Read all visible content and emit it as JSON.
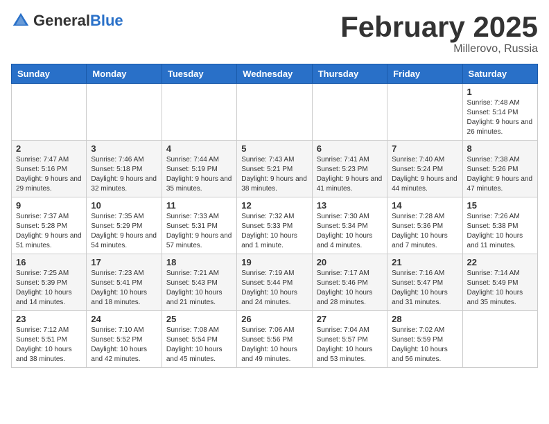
{
  "header": {
    "logo_general": "General",
    "logo_blue": "Blue",
    "month_title": "February 2025",
    "subtitle": "Millerovo, Russia"
  },
  "days_of_week": [
    "Sunday",
    "Monday",
    "Tuesday",
    "Wednesday",
    "Thursday",
    "Friday",
    "Saturday"
  ],
  "weeks": [
    [
      {
        "day": "",
        "detail": ""
      },
      {
        "day": "",
        "detail": ""
      },
      {
        "day": "",
        "detail": ""
      },
      {
        "day": "",
        "detail": ""
      },
      {
        "day": "",
        "detail": ""
      },
      {
        "day": "",
        "detail": ""
      },
      {
        "day": "1",
        "detail": "Sunrise: 7:48 AM\nSunset: 5:14 PM\nDaylight: 9 hours and 26 minutes."
      }
    ],
    [
      {
        "day": "2",
        "detail": "Sunrise: 7:47 AM\nSunset: 5:16 PM\nDaylight: 9 hours and 29 minutes."
      },
      {
        "day": "3",
        "detail": "Sunrise: 7:46 AM\nSunset: 5:18 PM\nDaylight: 9 hours and 32 minutes."
      },
      {
        "day": "4",
        "detail": "Sunrise: 7:44 AM\nSunset: 5:19 PM\nDaylight: 9 hours and 35 minutes."
      },
      {
        "day": "5",
        "detail": "Sunrise: 7:43 AM\nSunset: 5:21 PM\nDaylight: 9 hours and 38 minutes."
      },
      {
        "day": "6",
        "detail": "Sunrise: 7:41 AM\nSunset: 5:23 PM\nDaylight: 9 hours and 41 minutes."
      },
      {
        "day": "7",
        "detail": "Sunrise: 7:40 AM\nSunset: 5:24 PM\nDaylight: 9 hours and 44 minutes."
      },
      {
        "day": "8",
        "detail": "Sunrise: 7:38 AM\nSunset: 5:26 PM\nDaylight: 9 hours and 47 minutes."
      }
    ],
    [
      {
        "day": "9",
        "detail": "Sunrise: 7:37 AM\nSunset: 5:28 PM\nDaylight: 9 hours and 51 minutes."
      },
      {
        "day": "10",
        "detail": "Sunrise: 7:35 AM\nSunset: 5:29 PM\nDaylight: 9 hours and 54 minutes."
      },
      {
        "day": "11",
        "detail": "Sunrise: 7:33 AM\nSunset: 5:31 PM\nDaylight: 9 hours and 57 minutes."
      },
      {
        "day": "12",
        "detail": "Sunrise: 7:32 AM\nSunset: 5:33 PM\nDaylight: 10 hours and 1 minute."
      },
      {
        "day": "13",
        "detail": "Sunrise: 7:30 AM\nSunset: 5:34 PM\nDaylight: 10 hours and 4 minutes."
      },
      {
        "day": "14",
        "detail": "Sunrise: 7:28 AM\nSunset: 5:36 PM\nDaylight: 10 hours and 7 minutes."
      },
      {
        "day": "15",
        "detail": "Sunrise: 7:26 AM\nSunset: 5:38 PM\nDaylight: 10 hours and 11 minutes."
      }
    ],
    [
      {
        "day": "16",
        "detail": "Sunrise: 7:25 AM\nSunset: 5:39 PM\nDaylight: 10 hours and 14 minutes."
      },
      {
        "day": "17",
        "detail": "Sunrise: 7:23 AM\nSunset: 5:41 PM\nDaylight: 10 hours and 18 minutes."
      },
      {
        "day": "18",
        "detail": "Sunrise: 7:21 AM\nSunset: 5:43 PM\nDaylight: 10 hours and 21 minutes."
      },
      {
        "day": "19",
        "detail": "Sunrise: 7:19 AM\nSunset: 5:44 PM\nDaylight: 10 hours and 24 minutes."
      },
      {
        "day": "20",
        "detail": "Sunrise: 7:17 AM\nSunset: 5:46 PM\nDaylight: 10 hours and 28 minutes."
      },
      {
        "day": "21",
        "detail": "Sunrise: 7:16 AM\nSunset: 5:47 PM\nDaylight: 10 hours and 31 minutes."
      },
      {
        "day": "22",
        "detail": "Sunrise: 7:14 AM\nSunset: 5:49 PM\nDaylight: 10 hours and 35 minutes."
      }
    ],
    [
      {
        "day": "23",
        "detail": "Sunrise: 7:12 AM\nSunset: 5:51 PM\nDaylight: 10 hours and 38 minutes."
      },
      {
        "day": "24",
        "detail": "Sunrise: 7:10 AM\nSunset: 5:52 PM\nDaylight: 10 hours and 42 minutes."
      },
      {
        "day": "25",
        "detail": "Sunrise: 7:08 AM\nSunset: 5:54 PM\nDaylight: 10 hours and 45 minutes."
      },
      {
        "day": "26",
        "detail": "Sunrise: 7:06 AM\nSunset: 5:56 PM\nDaylight: 10 hours and 49 minutes."
      },
      {
        "day": "27",
        "detail": "Sunrise: 7:04 AM\nSunset: 5:57 PM\nDaylight: 10 hours and 53 minutes."
      },
      {
        "day": "28",
        "detail": "Sunrise: 7:02 AM\nSunset: 5:59 PM\nDaylight: 10 hours and 56 minutes."
      },
      {
        "day": "",
        "detail": ""
      }
    ]
  ]
}
